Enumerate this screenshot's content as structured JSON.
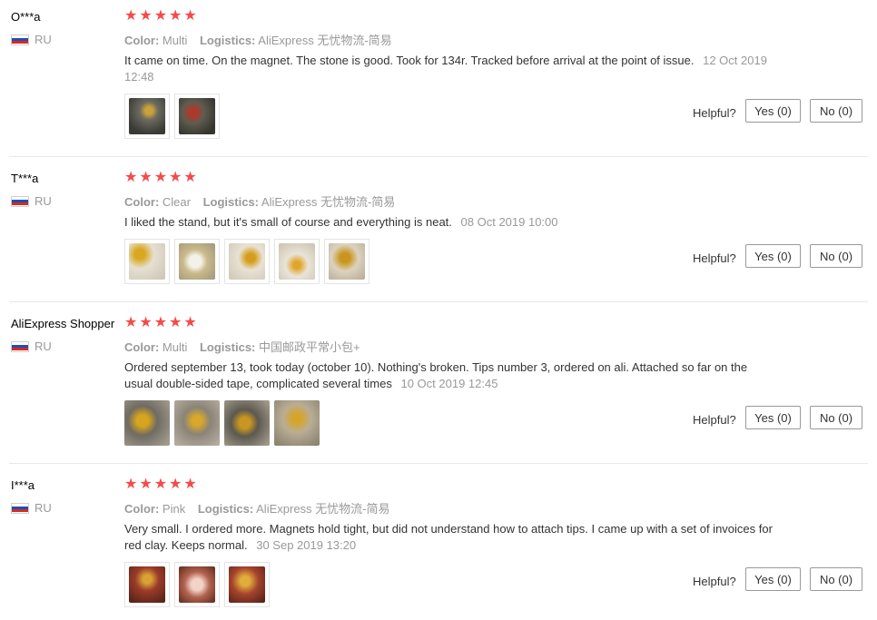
{
  "reviews": [
    {
      "user": "O***a",
      "country": "RU",
      "stars": "★★★★★",
      "color_label": "Color:",
      "color_value": "Multi",
      "logistics_label": "Logistics:",
      "logistics_value": "AliExpress 无忧物流-简易",
      "text": "It came on time. On the magnet. The stone is good. Took for 134r. Tracked before arrival at the point of issue.",
      "date": "12 Oct 2019 12:48",
      "helpful_label": "Helpful?",
      "yes_label": "Yes (0)",
      "no_label": "No (0)"
    },
    {
      "user": "T***a",
      "country": "RU",
      "stars": "★★★★★",
      "color_label": "Color:",
      "color_value": "Clear",
      "logistics_label": "Logistics:",
      "logistics_value": "AliExpress 无忧物流-简易",
      "text": "I liked the stand, but it's small of course and everything is neat.",
      "date": "08 Oct 2019 10:00",
      "helpful_label": "Helpful?",
      "yes_label": "Yes (0)",
      "no_label": "No (0)"
    },
    {
      "user": "AliExpress Shopper",
      "country": "RU",
      "stars": "★★★★★",
      "color_label": "Color:",
      "color_value": "Multi",
      "logistics_label": "Logistics:",
      "logistics_value": "中国邮政平常小包+",
      "text": "Ordered september 13, took today (october 10). Nothing's broken. Tips number 3, ordered on ali. Attached so far on the usual double-sided tape, complicated several times",
      "date": "10 Oct 2019 12:45",
      "helpful_label": "Helpful?",
      "yes_label": "Yes (0)",
      "no_label": "No (0)"
    },
    {
      "user": "I***a",
      "country": "RU",
      "stars": "★★★★★",
      "color_label": "Color:",
      "color_value": "Pink",
      "logistics_label": "Logistics:",
      "logistics_value": "AliExpress 无忧物流-简易",
      "text": "Very small. I ordered more. Magnets hold tight, but did not understand how to attach tips. I came up with a set of invoices for red clay. Keeps normal.",
      "date": "30 Sep 2019 13:20",
      "helpful_label": "Helpful?",
      "yes_label": "Yes (0)",
      "no_label": "No (0)"
    }
  ],
  "colors": {
    "star": "#f34b4b",
    "meta_text": "#999999",
    "body_text": "#333333"
  }
}
